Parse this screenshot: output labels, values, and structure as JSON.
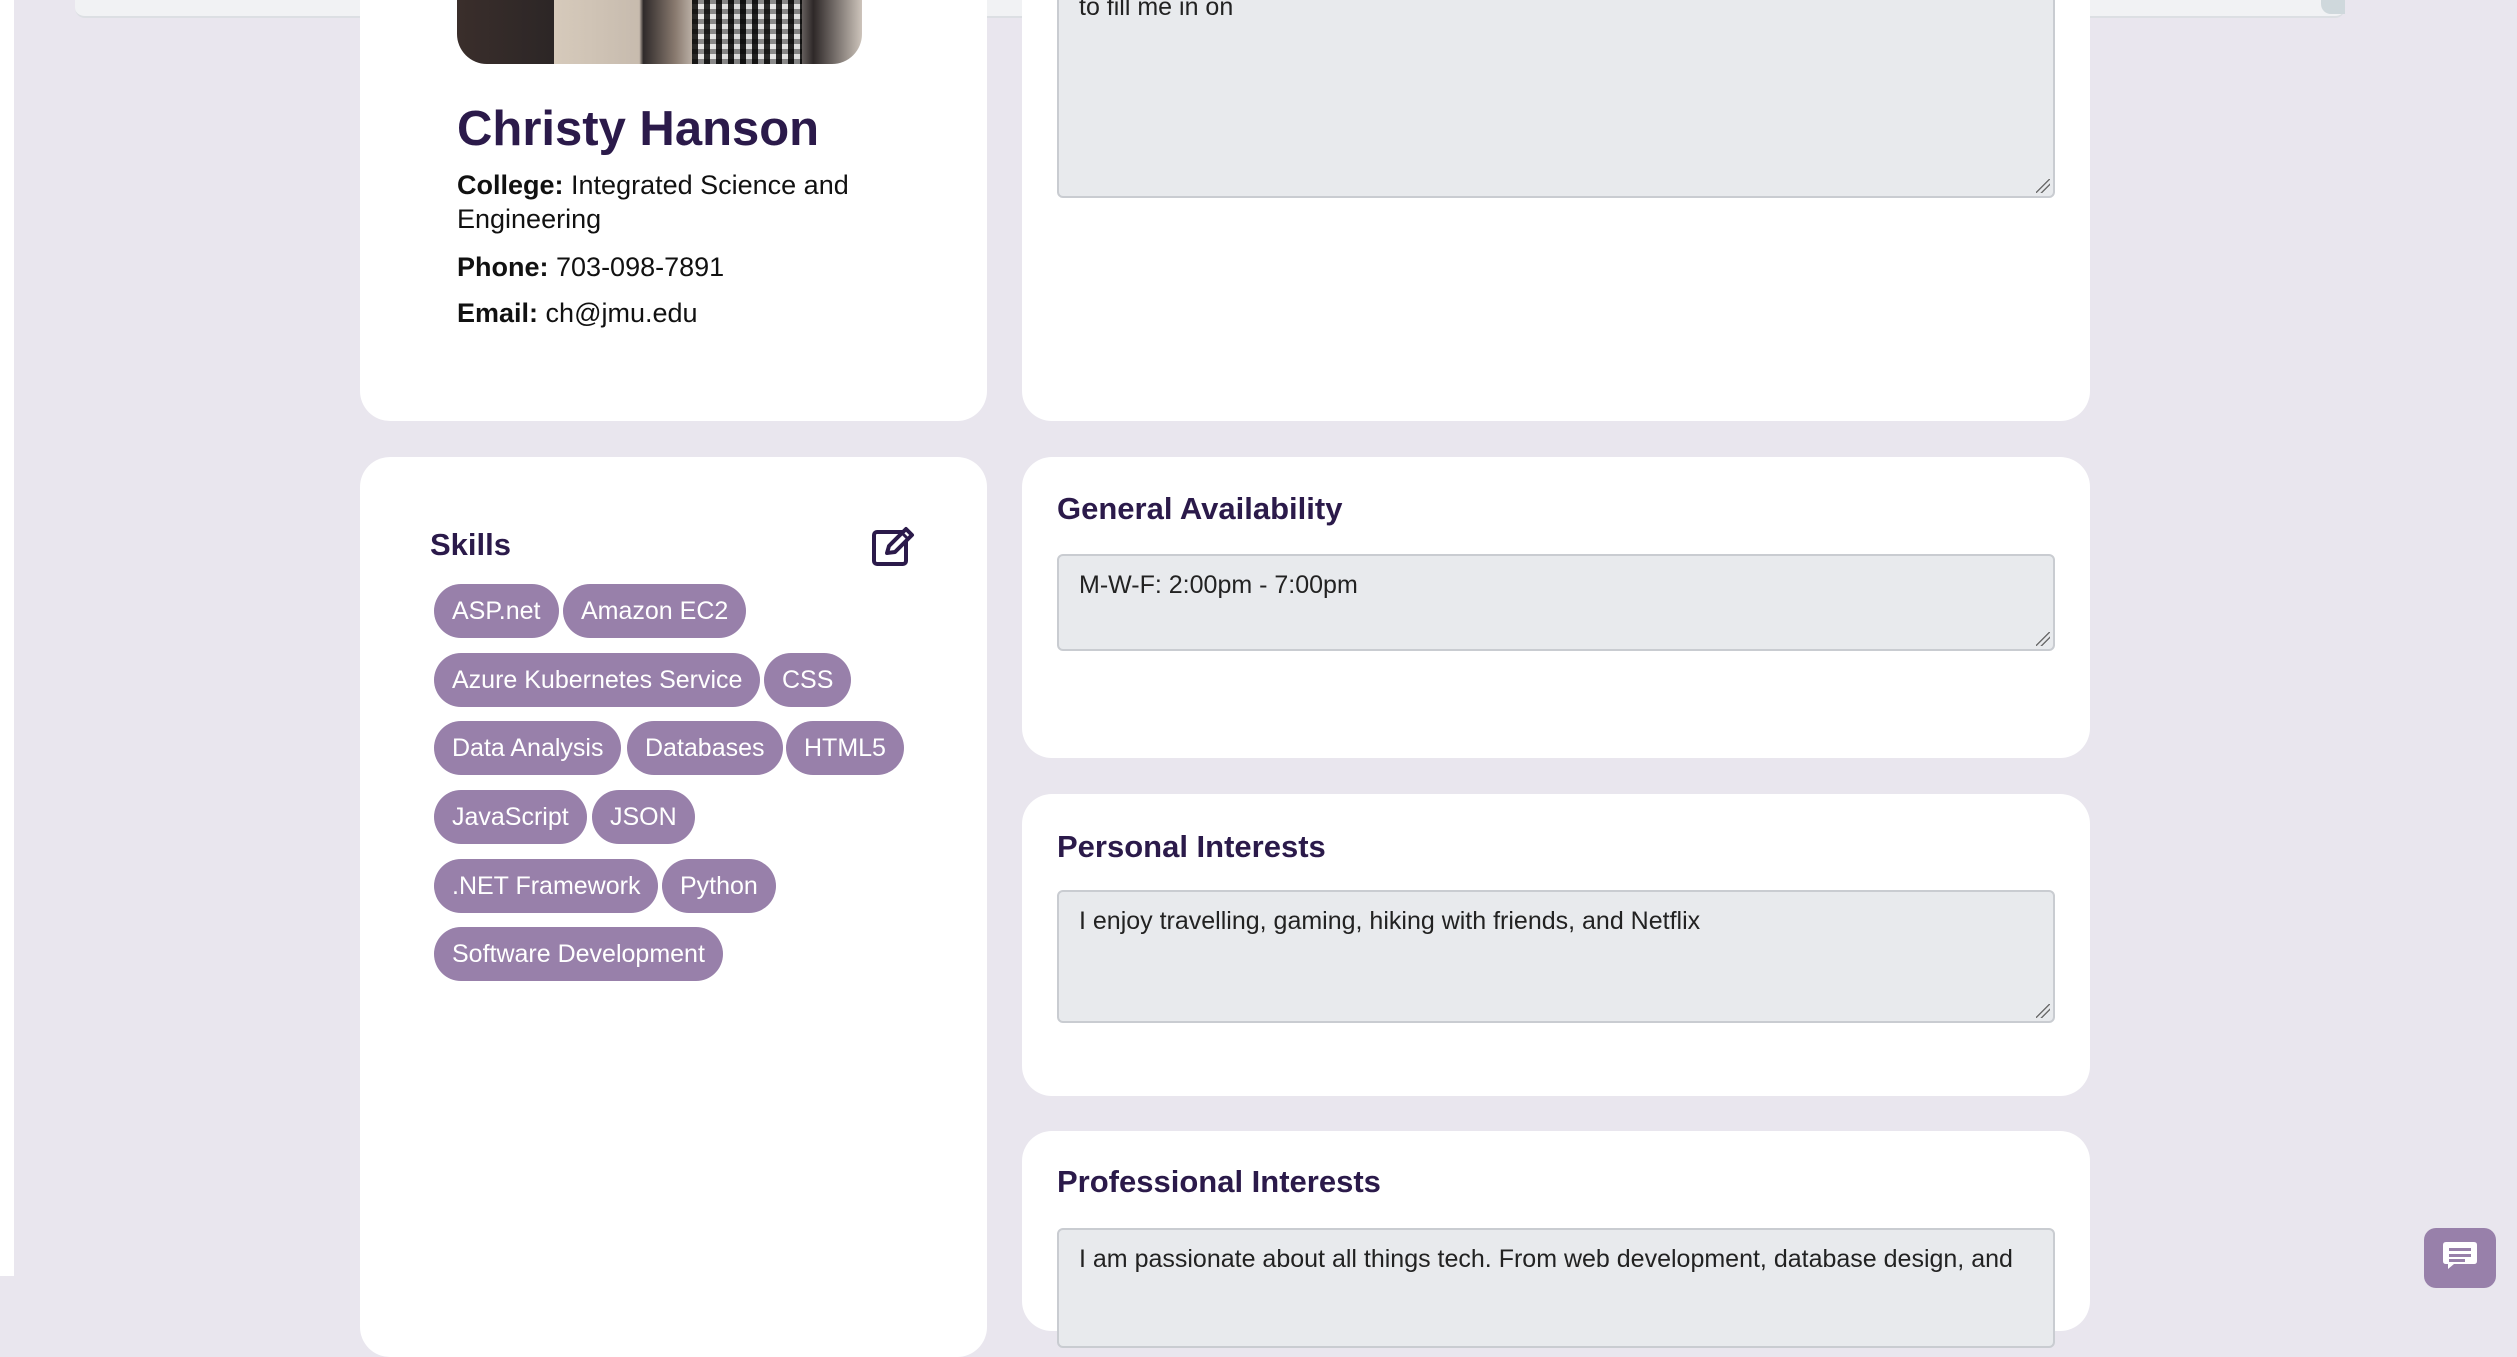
{
  "profile": {
    "name": "Christy Hanson",
    "college_label": "College:",
    "college_value": "Integrated Science and Engineering",
    "phone_label": "Phone:",
    "phone_value": "703-098-7891",
    "email_label": "Email:",
    "email_value": "ch@jmu.edu"
  },
  "top_textarea": {
    "partial_text": "to fill me in on"
  },
  "skills": {
    "title": "Skills",
    "edit_icon": "edit-icon",
    "items": [
      "ASP.net",
      "Amazon EC2",
      "Azure Kubernetes Service",
      "CSS",
      "Data Analysis",
      "Databases",
      "HTML5",
      "JavaScript",
      "JSON",
      ".NET Framework",
      "Python",
      "Software Development"
    ]
  },
  "availability": {
    "title": "General Availability",
    "value": "M-W-F: 2:00pm - 7:00pm"
  },
  "personal_interests": {
    "title": "Personal Interests",
    "value": "I enjoy travelling, gaming, hiking with friends, and Netflix"
  },
  "professional_interests": {
    "title": "Professional Interests",
    "value": "I am passionate about all things tech. From web development, database design, and"
  },
  "chat": {
    "icon": "chat-icon"
  },
  "colors": {
    "page_background": "#e9e6ee",
    "heading": "#2b1a4a",
    "chip": "#9880aa",
    "textarea": "#e8eaed"
  }
}
